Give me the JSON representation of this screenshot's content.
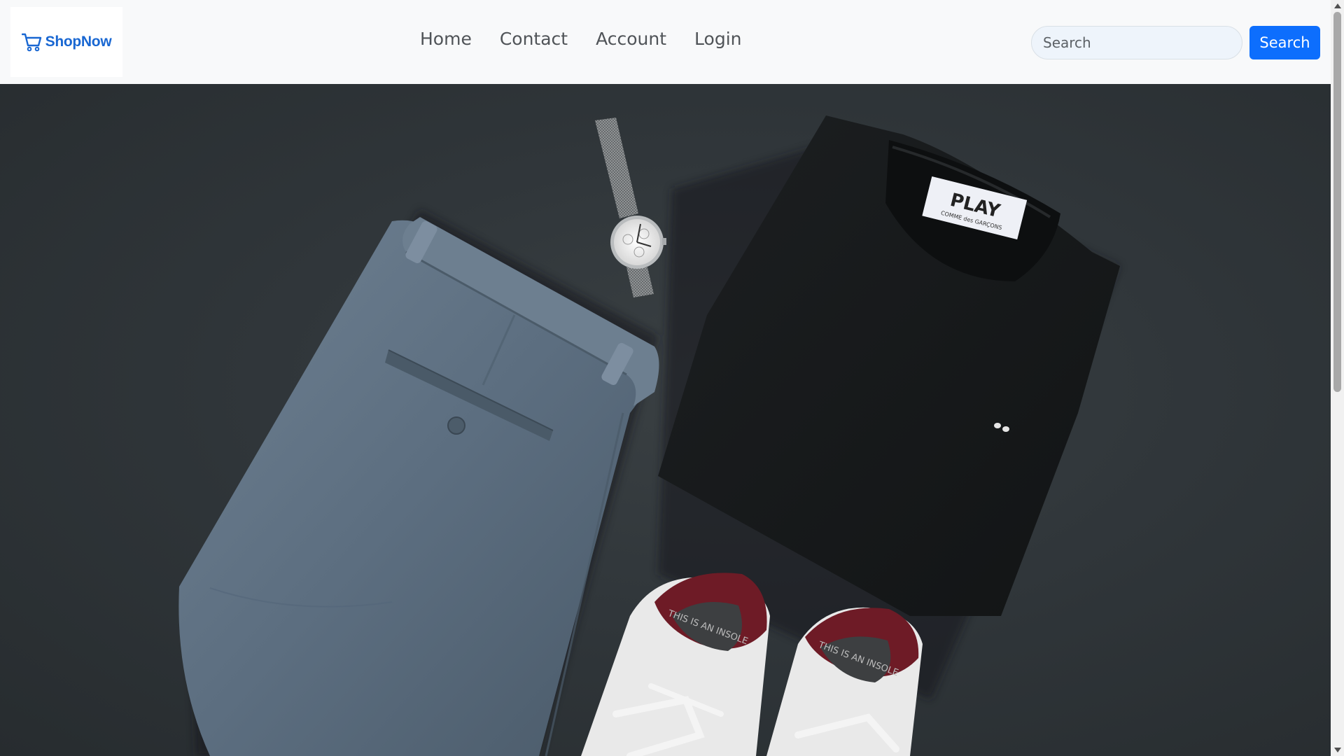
{
  "brand": {
    "name": "ShopNow",
    "icon": "shopping-cart-icon",
    "color": "#1967d2"
  },
  "nav": {
    "items": [
      {
        "label": "Home"
      },
      {
        "label": "Contact"
      },
      {
        "label": "Account"
      },
      {
        "label": "Login"
      }
    ]
  },
  "search": {
    "placeholder": "Search",
    "value": "",
    "button_label": "Search"
  },
  "hero": {
    "image": "product-flatlay-image",
    "shirt_tag_text": "PLAY",
    "shirt_tag_subtext": "COMME des GARÇONS",
    "insole_text": "THIS IS AN INSOLE"
  },
  "colors": {
    "accent": "#0d6efd",
    "navbar_bg": "#f8f9fa",
    "hero_bg": "#30363a"
  }
}
